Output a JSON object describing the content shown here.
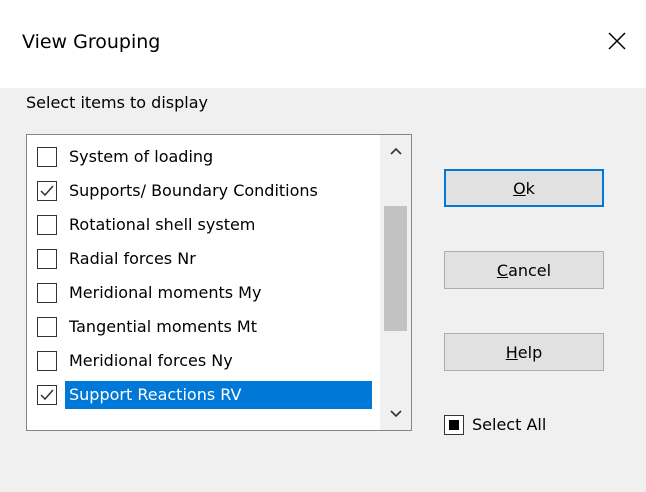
{
  "window": {
    "title": "View Grouping"
  },
  "prompt": "Select items to display",
  "list": {
    "items": [
      {
        "label": "System of loading",
        "checked": false,
        "selected": false
      },
      {
        "label": "Supports/ Boundary Conditions",
        "checked": true,
        "selected": false
      },
      {
        "label": "Rotational shell system",
        "checked": false,
        "selected": false
      },
      {
        "label": "Radial forces Nr",
        "checked": false,
        "selected": false
      },
      {
        "label": "Meridional moments My",
        "checked": false,
        "selected": false
      },
      {
        "label": "Tangential moments Mt",
        "checked": false,
        "selected": false
      },
      {
        "label": "Meridional forces Ny",
        "checked": false,
        "selected": false
      },
      {
        "label": "Support Reactions RV",
        "checked": true,
        "selected": true
      }
    ]
  },
  "buttons": {
    "ok": {
      "mnemonic": "O",
      "rest": "k"
    },
    "cancel": {
      "mnemonic": "C",
      "rest": "ancel"
    },
    "help": {
      "mnemonic": "H",
      "rest": "elp"
    }
  },
  "select_all": {
    "label": "Select All",
    "state": "indeterminate"
  },
  "colors": {
    "selection": "#0078d7",
    "dialog_bg": "#f0f0f0",
    "button_bg": "#e1e1e1"
  },
  "icons": {
    "close": "close-icon",
    "scroll_up": "chevron-up-icon",
    "scroll_down": "chevron-down-icon",
    "check": "checkmark-icon"
  }
}
